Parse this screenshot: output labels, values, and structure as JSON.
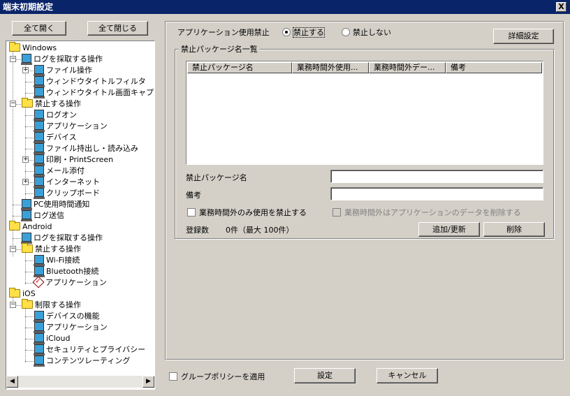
{
  "window": {
    "title": "端末初期設定",
    "close_label": "X"
  },
  "tree_buttons": {
    "expand_all": "全て開く",
    "collapse_all": "全て閉じる"
  },
  "tree": [
    {
      "label": "Windows",
      "icon": "folder-icon",
      "level": 0
    },
    {
      "label": "ログを採取する操作",
      "icon": "pc-icon",
      "level": 1,
      "toggle": "−"
    },
    {
      "label": "ファイル操作",
      "icon": "pc-icon",
      "level": 2,
      "toggle": "+"
    },
    {
      "label": "ウィンドウタイトルフィルタ",
      "icon": "pc-icon",
      "level": 2
    },
    {
      "label": "ウィンドウタイトル画面キャプチ",
      "icon": "pc-icon",
      "level": 2
    },
    {
      "label": "禁止する操作",
      "icon": "folder-icon",
      "level": 1,
      "toggle": "−"
    },
    {
      "label": "ログオン",
      "icon": "pc-icon",
      "level": 2
    },
    {
      "label": "アプリケーション",
      "icon": "pc-icon",
      "level": 2
    },
    {
      "label": "デバイス",
      "icon": "pc-icon",
      "level": 2
    },
    {
      "label": "ファイル持出し・読み込み",
      "icon": "pc-icon",
      "level": 2
    },
    {
      "label": "印刷・PrintScreen",
      "icon": "pc-icon",
      "level": 2,
      "toggle": "+"
    },
    {
      "label": "メール添付",
      "icon": "pc-icon",
      "level": 2
    },
    {
      "label": "インターネット",
      "icon": "pc-icon",
      "level": 2,
      "toggle": "+"
    },
    {
      "label": "クリップボード",
      "icon": "pc-icon",
      "level": 2
    },
    {
      "label": "PC使用時間通知",
      "icon": "pc-icon",
      "level": 1
    },
    {
      "label": "ログ送信",
      "icon": "pc-icon",
      "level": 1
    },
    {
      "label": "Android",
      "icon": "folder-icon",
      "level": 0
    },
    {
      "label": "ログを採取する操作",
      "icon": "pc-icon",
      "level": 1
    },
    {
      "label": "禁止する操作",
      "icon": "folder-icon",
      "level": 1,
      "toggle": "−"
    },
    {
      "label": "Wi-Fi接続",
      "icon": "pc-icon",
      "level": 2
    },
    {
      "label": "Bluetooth接続",
      "icon": "pc-icon",
      "level": 2
    },
    {
      "label": "アプリケーション",
      "icon": "app-check-icon",
      "level": 2
    },
    {
      "label": "iOS",
      "icon": "folder-icon",
      "level": 0
    },
    {
      "label": "制限する操作",
      "icon": "folder-icon",
      "level": 1,
      "toggle": "−"
    },
    {
      "label": "デバイスの機能",
      "icon": "pc-icon",
      "level": 2
    },
    {
      "label": "アプリケーション",
      "icon": "pc-icon",
      "level": 2
    },
    {
      "label": "iCloud",
      "icon": "pc-icon",
      "level": 2
    },
    {
      "label": "セキュリティとプライバシー",
      "icon": "pc-icon",
      "level": 2
    },
    {
      "label": "コンテンツレーティング",
      "icon": "pc-icon",
      "level": 2
    }
  ],
  "scroll": {
    "left": "◀",
    "right": "▶"
  },
  "app_ban": {
    "label": "アプリケーション使用禁止",
    "option_on": "禁止する",
    "option_off": "禁止しない",
    "selected": "禁止する"
  },
  "details_button": "詳細設定",
  "package_group": {
    "title": "禁止パッケージ名一覧",
    "columns": [
      "禁止パッケージ名",
      "業務時間外使用...",
      "業務時間外デー...",
      "備考"
    ],
    "rows": []
  },
  "form": {
    "package_name_label": "禁止パッケージ名",
    "package_name_value": "",
    "note_label": "備考",
    "note_value": "",
    "offhours_only_label": "業務時間外のみ使用を禁止する",
    "delete_data_label": "業務時間外はアプリケーションのデータを削除する",
    "count_label": "登録数",
    "count_value": "0件（最大 100件）",
    "add_update_button": "追加/更新",
    "delete_button": "削除"
  },
  "footer": {
    "group_policy_label": "グループポリシーを適用",
    "ok_button": "設定",
    "cancel_button": "キャンセル"
  }
}
